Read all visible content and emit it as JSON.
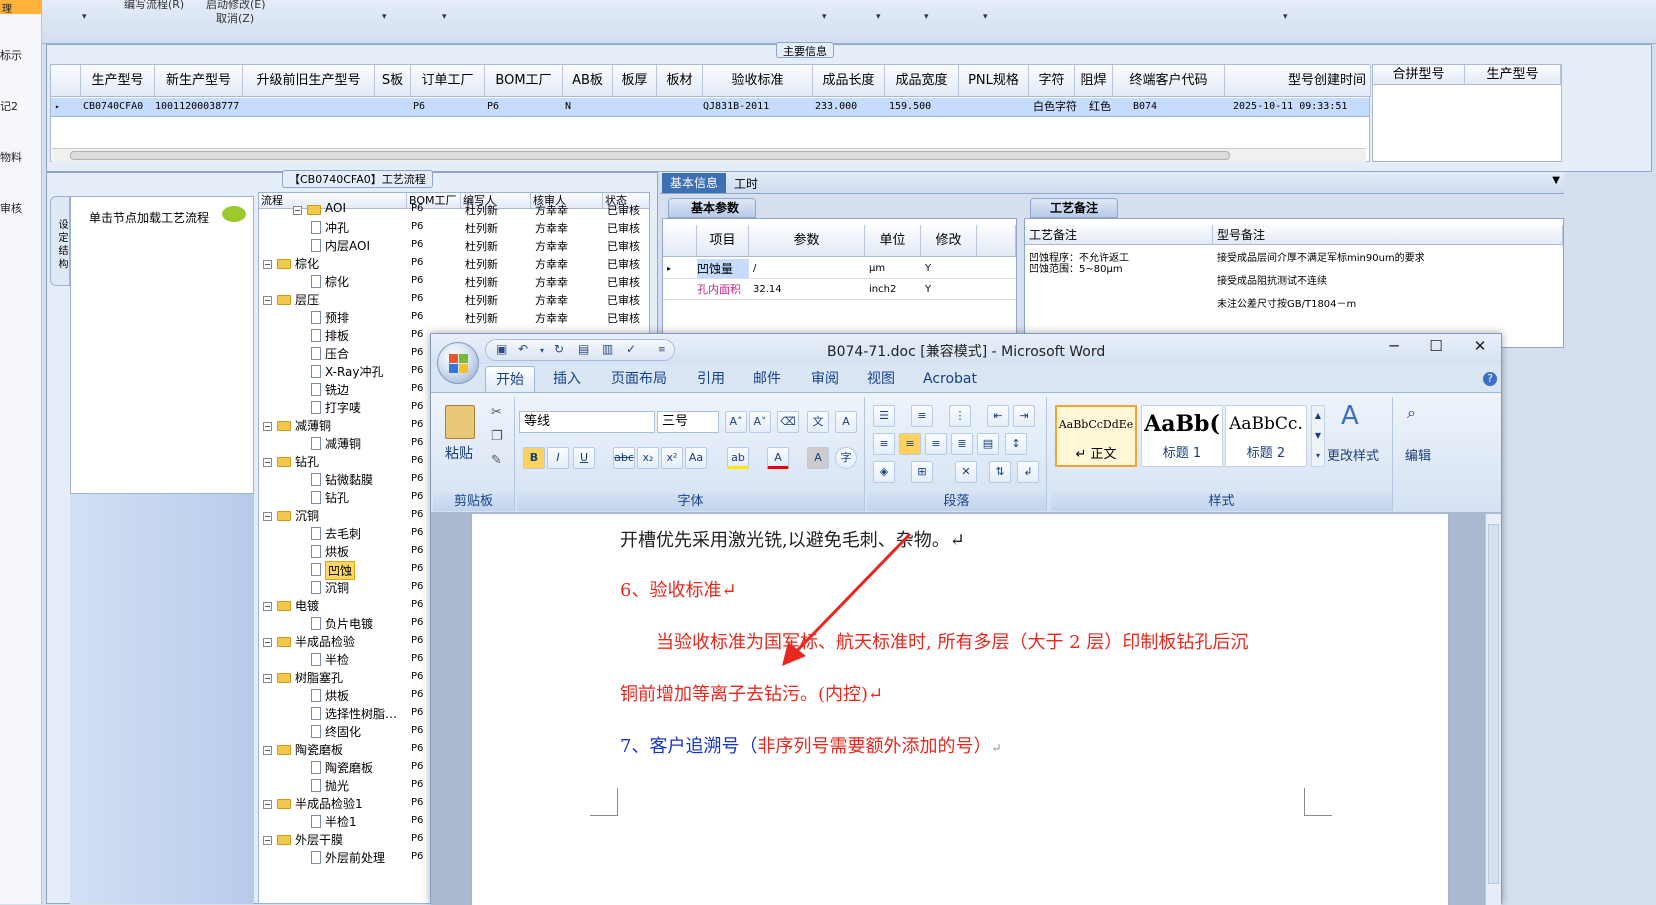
{
  "left_strip": {
    "items": [
      "理",
      "标示",
      "记2",
      "物料",
      "审核"
    ]
  },
  "toolbar": {
    "edit_flow": "编写流程(R)",
    "start_modify": "启动修改(E)",
    "cancel": "取消(Z)"
  },
  "main_info": {
    "title": "主要信息",
    "columns": [
      "生产型号",
      "新生产型号",
      "升级前旧生产型号",
      "S板",
      "订单工厂",
      "BOM工厂",
      "AB板",
      "板厚",
      "板材",
      "验收标准",
      "成品长度",
      "成品宽度",
      "PNL规格",
      "字符",
      "阻焊",
      "终端客户代码",
      "型号创建时间"
    ],
    "row": [
      "CB0740CFA0",
      "10011200038777",
      "",
      "",
      "P6",
      "P6",
      "N",
      "",
      "",
      "QJ831B-2011",
      "233.000",
      "159.500",
      "",
      "白色字符",
      "红色",
      "B074",
      "2025-10-11 09:33:51"
    ],
    "merge_columns": [
      "合拼型号",
      "生产型号"
    ]
  },
  "flow": {
    "title": "【CB0740CFA0】工艺流程",
    "side_tab": "设 定 结 构",
    "node_hint": "单击节点加载工艺流程",
    "columns": [
      "流程",
      "BOM工厂",
      "编写人",
      "核审人",
      "状态"
    ],
    "rows": [
      {
        "name": "AOI",
        "level": 1,
        "folder": true,
        "bom": "P6",
        "writer": "杜列新",
        "reviewer": "方幸幸",
        "status": "已审核"
      },
      {
        "name": "冲孔",
        "level": 1,
        "folder": false,
        "bom": "P6",
        "writer": "杜列新",
        "reviewer": "方幸幸",
        "status": "已审核"
      },
      {
        "name": "内层AOI",
        "level": 1,
        "folder": false,
        "bom": "P6",
        "writer": "杜列新",
        "reviewer": "方幸幸",
        "status": "已审核"
      },
      {
        "name": "棕化",
        "level": 0,
        "folder": true,
        "bom": "P6",
        "writer": "杜列新",
        "reviewer": "方幸幸",
        "status": "已审核"
      },
      {
        "name": "棕化",
        "level": 1,
        "folder": false,
        "bom": "P6",
        "writer": "杜列新",
        "reviewer": "方幸幸",
        "status": "已审核"
      },
      {
        "name": "层压",
        "level": 0,
        "folder": true,
        "bom": "P6",
        "writer": "杜列新",
        "reviewer": "方幸幸",
        "status": "已审核"
      },
      {
        "name": "预排",
        "level": 1,
        "folder": false,
        "bom": "P6",
        "writer": "杜列新",
        "reviewer": "方幸幸",
        "status": "已审核"
      },
      {
        "name": "排板",
        "level": 1,
        "folder": false,
        "bom": "P6",
        "writer": "",
        "reviewer": "",
        "status": ""
      },
      {
        "name": "压合",
        "level": 1,
        "folder": false,
        "bom": "P6",
        "writer": "",
        "reviewer": "",
        "status": ""
      },
      {
        "name": "X-Ray冲孔",
        "level": 1,
        "folder": false,
        "bom": "P6",
        "writer": "",
        "reviewer": "",
        "status": ""
      },
      {
        "name": "铣边",
        "level": 1,
        "folder": false,
        "bom": "P6",
        "writer": "",
        "reviewer": "",
        "status": ""
      },
      {
        "name": "打字唛",
        "level": 1,
        "folder": false,
        "bom": "P6",
        "writer": "",
        "reviewer": "",
        "status": ""
      },
      {
        "name": "减薄铜",
        "level": 0,
        "folder": true,
        "bom": "P6",
        "writer": "",
        "reviewer": "",
        "status": ""
      },
      {
        "name": "减薄铜",
        "level": 1,
        "folder": false,
        "bom": "P6",
        "writer": "",
        "reviewer": "",
        "status": ""
      },
      {
        "name": "钻孔",
        "level": 0,
        "folder": true,
        "bom": "P6",
        "writer": "",
        "reviewer": "",
        "status": ""
      },
      {
        "name": "钻微黏膜",
        "level": 1,
        "folder": false,
        "bom": "P6",
        "writer": "",
        "reviewer": "",
        "status": ""
      },
      {
        "name": "钻孔",
        "level": 1,
        "folder": false,
        "bom": "P6",
        "writer": "",
        "reviewer": "",
        "status": ""
      },
      {
        "name": "沉铜",
        "level": 0,
        "folder": true,
        "bom": "P6",
        "writer": "",
        "reviewer": "",
        "status": ""
      },
      {
        "name": "去毛刺",
        "level": 1,
        "folder": false,
        "bom": "P6",
        "writer": "",
        "reviewer": "",
        "status": ""
      },
      {
        "name": "烘板",
        "level": 1,
        "folder": false,
        "bom": "P6",
        "writer": "",
        "reviewer": "",
        "status": ""
      },
      {
        "name": "凹蚀",
        "level": 1,
        "folder": false,
        "bom": "P6",
        "writer": "",
        "reviewer": "",
        "status": "",
        "selected": true
      },
      {
        "name": "沉铜",
        "level": 1,
        "folder": false,
        "bom": "P6",
        "writer": "",
        "reviewer": "",
        "status": ""
      },
      {
        "name": "电镀",
        "level": 0,
        "folder": true,
        "bom": "P6",
        "writer": "",
        "reviewer": "",
        "status": ""
      },
      {
        "name": "负片电镀",
        "level": 1,
        "folder": false,
        "bom": "P6",
        "writer": "",
        "reviewer": "",
        "status": ""
      },
      {
        "name": "半成品检验",
        "level": 0,
        "folder": true,
        "bom": "P6",
        "writer": "",
        "reviewer": "",
        "status": ""
      },
      {
        "name": "半检",
        "level": 1,
        "folder": false,
        "bom": "P6",
        "writer": "",
        "reviewer": "",
        "status": ""
      },
      {
        "name": "树脂塞孔",
        "level": 0,
        "folder": true,
        "bom": "P6",
        "writer": "",
        "reviewer": "",
        "status": ""
      },
      {
        "name": "烘板",
        "level": 1,
        "folder": false,
        "bom": "P6",
        "writer": "",
        "reviewer": "",
        "status": ""
      },
      {
        "name": "选择性树脂…",
        "level": 1,
        "folder": false,
        "bom": "P6",
        "writer": "",
        "reviewer": "",
        "status": ""
      },
      {
        "name": "终固化",
        "level": 1,
        "folder": false,
        "bom": "P6",
        "writer": "",
        "reviewer": "",
        "status": ""
      },
      {
        "name": "陶瓷磨板",
        "level": 0,
        "folder": true,
        "bom": "P6",
        "writer": "",
        "reviewer": "",
        "status": ""
      },
      {
        "name": "陶瓷磨板",
        "level": 1,
        "folder": false,
        "bom": "P6",
        "writer": "",
        "reviewer": "",
        "status": ""
      },
      {
        "name": "抛光",
        "level": 1,
        "folder": false,
        "bom": "P6",
        "writer": "",
        "reviewer": "",
        "status": ""
      },
      {
        "name": "半成品检验1",
        "level": 0,
        "folder": true,
        "bom": "P6",
        "writer": "",
        "reviewer": "",
        "status": ""
      },
      {
        "name": "半检1",
        "level": 1,
        "folder": false,
        "bom": "P6",
        "writer": "",
        "reviewer": "",
        "status": ""
      },
      {
        "name": "外层干膜",
        "level": 0,
        "folder": true,
        "bom": "P6",
        "writer": "",
        "reviewer": "",
        "status": ""
      },
      {
        "name": "外层前处理",
        "level": 1,
        "folder": false,
        "bom": "P6",
        "writer": "",
        "reviewer": "",
        "status": ""
      }
    ]
  },
  "right_tabs": {
    "basic": "基本信息",
    "hours": "工时"
  },
  "basic_params": {
    "title": "基本参数",
    "columns": [
      "项目",
      "参数",
      "单位",
      "修改"
    ],
    "rows": [
      {
        "item": "凹蚀量",
        "param": "/",
        "unit": "μm",
        "edit": "Y"
      },
      {
        "item": "孔内面积",
        "param": "32.14",
        "unit": "inch2",
        "edit": "Y"
      }
    ]
  },
  "process_notes": {
    "title": "工艺备注",
    "col1": "工艺备注",
    "col2": "型号备注",
    "note1_lines": [
      "凹蚀程序：不允许返工",
      "凹蚀范围：5~80μm"
    ],
    "note2_lines": [
      "接受成品层间介厚不满足军标min90um的要求",
      "接受成品阻抗测试不连续",
      "未注公差尺寸按GB/T1804－m"
    ]
  },
  "word": {
    "title": "B074-71.doc [兼容模式] - Microsoft Word",
    "tabs": [
      "开始",
      "插入",
      "页面布局",
      "引用",
      "邮件",
      "审阅",
      "视图",
      "Acrobat"
    ],
    "groups": {
      "clipboard": "剪贴板",
      "font": "字体",
      "paragraph": "段落",
      "styles": "样式"
    },
    "paste": "粘贴",
    "font_name": "等线",
    "font_size": "三号",
    "styles": [
      {
        "preview": "AaBbCcDdEe",
        "label": "↵ 正文"
      },
      {
        "preview": "AaBb(",
        "label": "标题 1"
      },
      {
        "preview": "AaBbCc.",
        "label": "标题 2"
      }
    ],
    "change_styles": "更改样式",
    "edit": "编辑",
    "doc_lines": [
      "开槽优先采用激光铣,以避免毛刺、杂物。↵",
      "6、验收标准↵",
      "当验收标准为国军标、航天标准时, 所有多层（大于 2 层）印制板钻孔后沉",
      "铜前增加等离子去钻污。(内控)↵",
      "7、客户追溯号（",
      "非序列号需要额外添加的号）",
      "↵"
    ],
    "colors": {
      "black": "#222222",
      "red": "#e8281e",
      "blue": "#1633c8"
    }
  }
}
